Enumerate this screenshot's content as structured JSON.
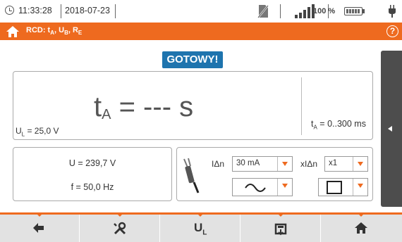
{
  "status": {
    "time": "11:33:28",
    "date": "2018-07-23",
    "battery_percent": "100 %",
    "icons": [
      "clock-icon",
      "sd-card-missing-icon",
      "signal-strength-icon",
      "battery-icon",
      "power-plug-icon"
    ]
  },
  "header": {
    "title": "RCD: t",
    "title_sub_a": "A",
    "title_sep1": ", U",
    "title_sub_b": "B",
    "title_sep2": ", R",
    "title_sub_e": "E",
    "help_label": "?"
  },
  "ready_label": "GOTOWY!",
  "result": {
    "symbol": "t",
    "symbol_sub": "A",
    "value_text": " = --- s",
    "ul_prefix": "U",
    "ul_sub": "L",
    "ul_value": " = 25,0 V",
    "range_prefix": "t",
    "range_sub": "A",
    "range_value": " = 0..300 ms"
  },
  "measurements": {
    "voltage": "U = 239,7 V",
    "frequency": "f = 50,0 Hz"
  },
  "settings": {
    "idn_label": "IΔn",
    "idn_value": "30 mA",
    "multiplier_label": "xIΔn",
    "multiplier_value": "x1",
    "waveform": "sine-ac",
    "rcd_type": "standard"
  },
  "nav": {
    "ul_label": "U",
    "ul_sub": "L",
    "buttons": [
      "back-arrow-icon",
      "settings-tools-icon",
      "ul-button",
      "save-memory-icon",
      "home-icon"
    ]
  },
  "colors": {
    "accent": "#ee6a1f",
    "badge": "#1e74ae",
    "side_tab": "#4d4d4d",
    "nav_bg": "#e2e2e2"
  }
}
